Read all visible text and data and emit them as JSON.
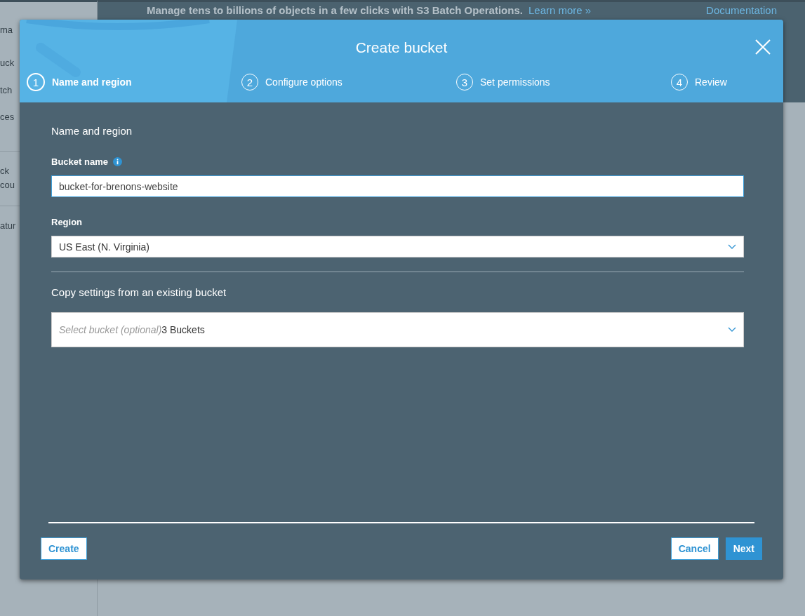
{
  "sidebar": {
    "items": [
      {
        "label": "ma"
      },
      {
        "label": "uck"
      },
      {
        "label": "tch"
      },
      {
        "label": "ces"
      },
      {
        "label": "ck"
      },
      {
        "label": "cou"
      },
      {
        "label": "atur"
      }
    ]
  },
  "banner": {
    "text": "Manage tens to billions of objects in a few clicks with S3 Batch Operations.",
    "link": "Learn more »",
    "documentation": "Documentation"
  },
  "dialog": {
    "title": "Create bucket",
    "steps": [
      {
        "number": "1",
        "label": "Name and region",
        "selected": true
      },
      {
        "number": "2",
        "label": "Configure options",
        "selected": false
      },
      {
        "number": "3",
        "label": "Set permissions",
        "selected": false
      },
      {
        "number": "4",
        "label": "Review",
        "selected": false
      }
    ],
    "section_title": "Name and region",
    "bucket_name": {
      "label": "Bucket name",
      "value": "bucket-for-brenons-website"
    },
    "region": {
      "label": "Region",
      "value": "US East (N. Virginia)"
    },
    "copy_settings": {
      "title": "Copy settings from an existing bucket",
      "placeholder": "Select bucket (optional)",
      "count": "3 Buckets"
    },
    "buttons": {
      "create": "Create",
      "cancel": "Cancel",
      "next": "Next"
    }
  }
}
